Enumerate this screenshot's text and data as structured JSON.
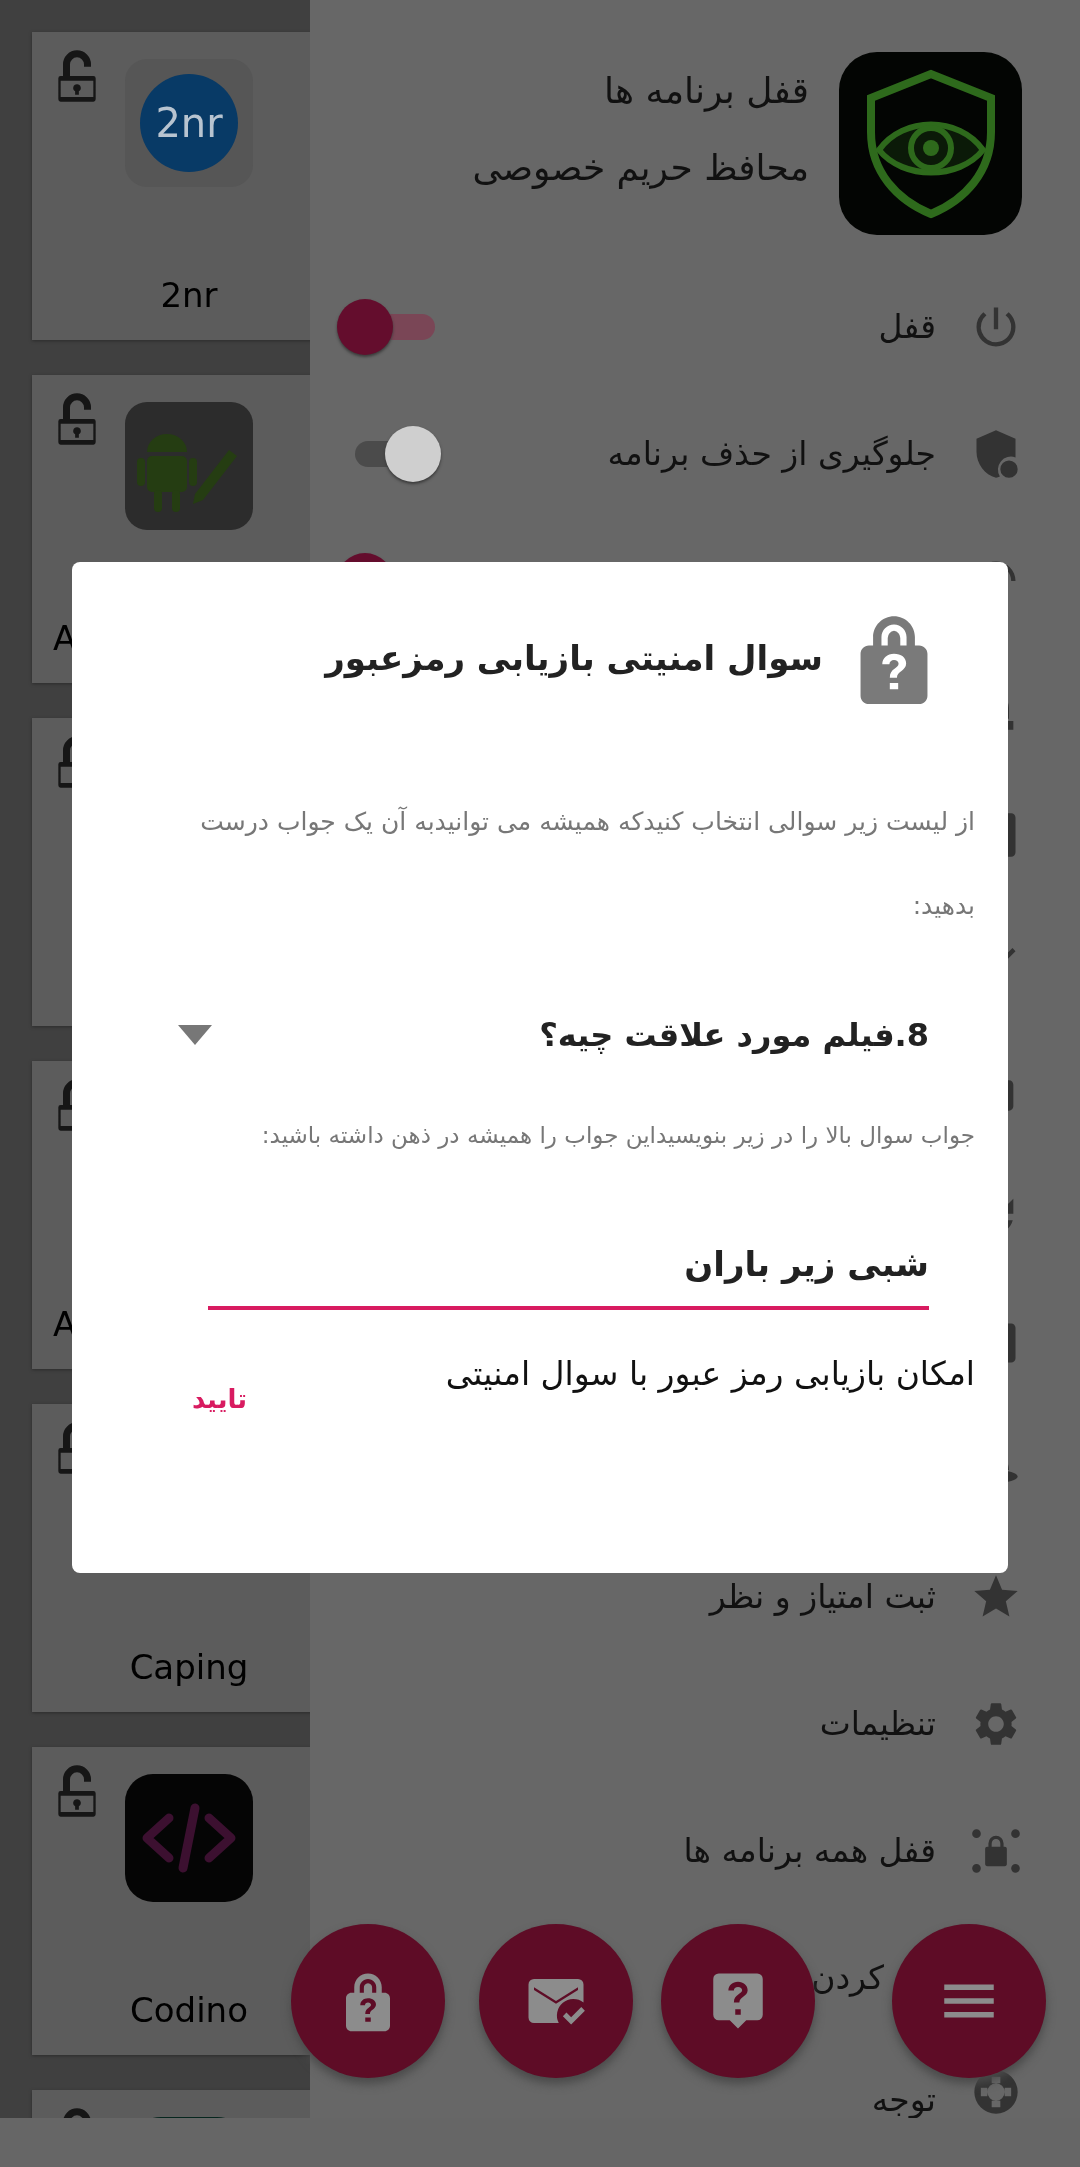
{
  "app_list": {
    "cards": [
      {
        "label": "2nr",
        "logo_text": "2nr",
        "locked": false,
        "label_clipped": false
      },
      {
        "label": "A",
        "locked": false,
        "label_clipped": true
      },
      {
        "locked": false
      },
      {
        "label": "A",
        "locked": false,
        "label_clipped": true
      },
      {
        "label": "Caping",
        "locked": false,
        "label_clipped": false
      },
      {
        "label": "Codino",
        "locked": false,
        "label_clipped": false
      },
      {
        "locked": false
      }
    ]
  },
  "drawer": {
    "title": "قفل برنامه ها",
    "subtitle": "محافظ حریم خصوصی",
    "items": [
      {
        "kind": "toggle",
        "label": "قفل",
        "on": true
      },
      {
        "kind": "toggle",
        "label": "جلوگیری از حذف برنامه",
        "on": false
      },
      {
        "kind": "toggle",
        "on": true
      },
      {
        "kind": "link"
      },
      {
        "kind": "link"
      },
      {
        "kind": "link"
      },
      {
        "kind": "link"
      },
      {
        "kind": "link"
      },
      {
        "kind": "link"
      },
      {
        "kind": "link"
      },
      {
        "kind": "link",
        "label": "ثبت امتیاز و نظر"
      },
      {
        "kind": "link",
        "label": "تنظیمات"
      },
      {
        "kind": "link",
        "label": "قفل همه برنامه ها"
      },
      {
        "kind": "link",
        "label": "کردن"
      },
      {
        "kind": "link",
        "label": "توجه"
      }
    ]
  },
  "dialog": {
    "title": "سوال امنیتی بازیابی رمزعبور",
    "instruction": "از لیست زیر سوالی انتخاب کنیدکه همیشه می توانیدبه آن یک جواب درست بدهید:",
    "question": "8.فیلم مورد علاقت چیه؟",
    "hint": "جواب سوال بالا را در زیر بنویسیداین جواب را همیشه در ذهن داشته باشید:",
    "answer": "شبی زیر باران",
    "option_label": "امکان بازیابی رمز عبور با سوال امنیتی",
    "confirm": "تایید"
  }
}
